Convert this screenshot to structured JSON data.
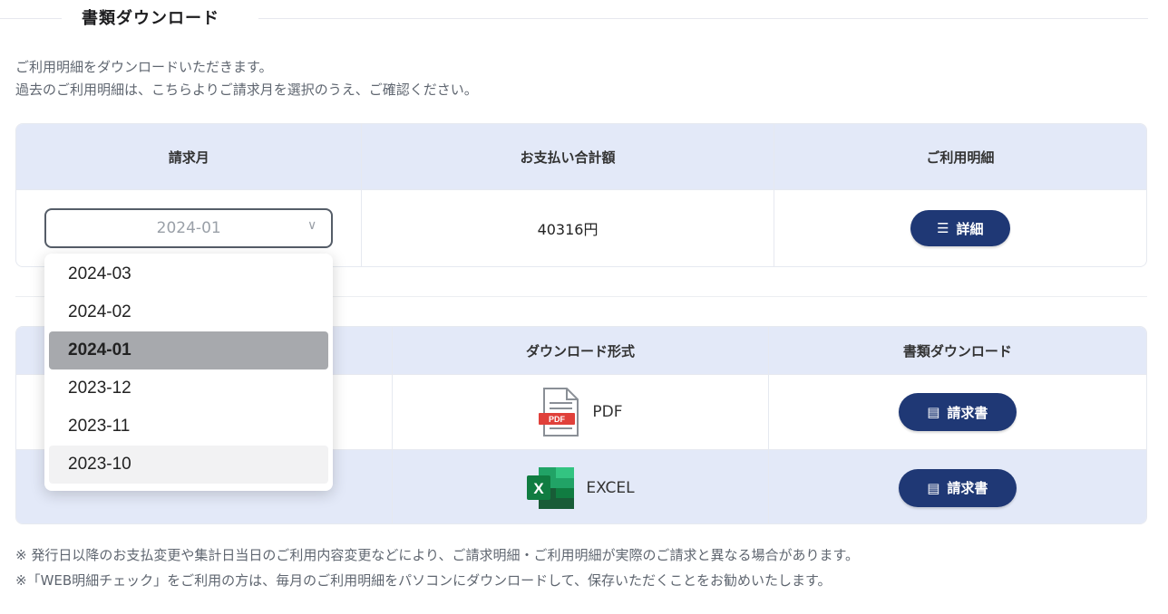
{
  "section": {
    "title": "書類ダウンロード"
  },
  "intro": {
    "line1": "ご利用明細をダウンロードいただきます。",
    "line2": "過去のご利用明細は、こちらよりご請求月を選択のうえ、ご確認ください。"
  },
  "summary_table": {
    "headers": [
      "請求月",
      "お支払い合計額",
      "ご利用明細"
    ],
    "select_value": "2024-01",
    "amount": "40316円",
    "detail_button": "詳細"
  },
  "download_table": {
    "headers": [
      "",
      "ダウンロード形式",
      "書類ダウンロード"
    ],
    "rows": [
      {
        "format": "PDF",
        "button": "請求書"
      },
      {
        "format": "EXCEL",
        "button": "請求書"
      }
    ]
  },
  "dropdown": {
    "options": [
      "2024-03",
      "2024-02",
      "2024-01",
      "2023-12",
      "2023-11",
      "2023-10"
    ],
    "selected": "2024-01",
    "hovered": "2023-10"
  },
  "notes": {
    "line1": "※ 発行日以降のお支払変更や集計日当日のご利用内容変更などにより、ご請求明細・ご利用明細が実際のご請求と異なる場合があります。",
    "line2": "※「WEB明細チェック」をご利用の方は、毎月のご利用明細をパソコンにダウンロードして、保存いただくことをお勧めいたします。"
  },
  "colors": {
    "header_bg": "#e3e9f8",
    "button_bg": "#1f3875",
    "pdf_red": "#e0403a",
    "excel_green": "#1e7145"
  }
}
